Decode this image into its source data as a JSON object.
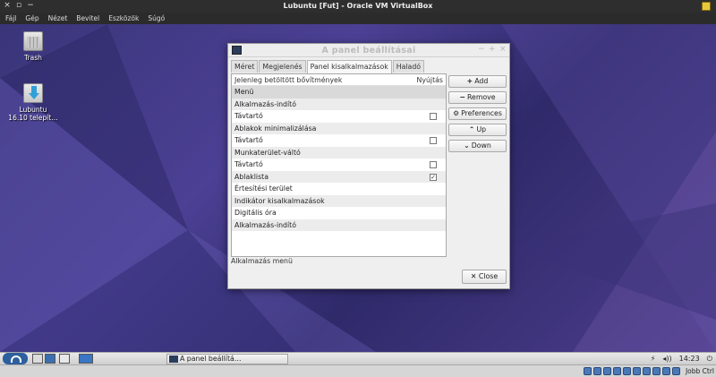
{
  "vbox": {
    "title": "Lubuntu [Fut] - Oracle VM VirtualBox",
    "window_controls": [
      "×",
      "▫",
      "−"
    ],
    "menu": [
      "Fájl",
      "Gép",
      "Nézet",
      "Bevitel",
      "Eszközök",
      "Súgó"
    ],
    "host_key": "Jobb Ctrl"
  },
  "desktop": {
    "icons": [
      {
        "label": "Trash"
      },
      {
        "label": "Lubuntu\n16.10 telepít…"
      }
    ]
  },
  "dialog": {
    "title": "A panel beállításai",
    "controls": [
      "−",
      "+",
      "×"
    ],
    "tabs": [
      "Méret",
      "Megjelenés",
      "Panel kisalkalmazások",
      "Haladó"
    ],
    "active_tab": "Panel kisalkalmazások",
    "list_header": {
      "left": "Jelenleg betöltött bővítmények",
      "right": "Nyújtás"
    },
    "rows": [
      {
        "label": "Menü",
        "selected": true
      },
      {
        "label": "Alkalmazás-indító"
      },
      {
        "label": "Távtartó",
        "checkbox": "☐"
      },
      {
        "label": "Ablakok minimalizálása"
      },
      {
        "label": "Távtartó",
        "checkbox": "☐"
      },
      {
        "label": "Munkaterület-váltó"
      },
      {
        "label": "Távtartó",
        "checkbox": "☐"
      },
      {
        "label": "Ablaklista",
        "checkbox": "☑"
      },
      {
        "label": "Értesítési terület"
      },
      {
        "label": "Indikátor kisalkalmazások"
      },
      {
        "label": "Digitális óra"
      },
      {
        "label": "Alkalmazás-indító"
      }
    ],
    "status": "Alkalmazás menü",
    "buttons": {
      "add": {
        "glyph": "+",
        "label": "Add"
      },
      "remove": {
        "glyph": "−",
        "label": "Remove"
      },
      "preferences": {
        "glyph": "⚙",
        "label": "Preferences"
      },
      "up": {
        "glyph": "⌃",
        "label": "Up"
      },
      "down": {
        "glyph": "⌄",
        "label": "Down"
      }
    },
    "close": {
      "glyph": "✕",
      "label": "Close"
    }
  },
  "taskbar": {
    "task_label": "A panel beállítá…",
    "tray": {
      "battery": "⚡",
      "volume": "◂))",
      "clock": "14:23",
      "power": "⏻"
    }
  }
}
